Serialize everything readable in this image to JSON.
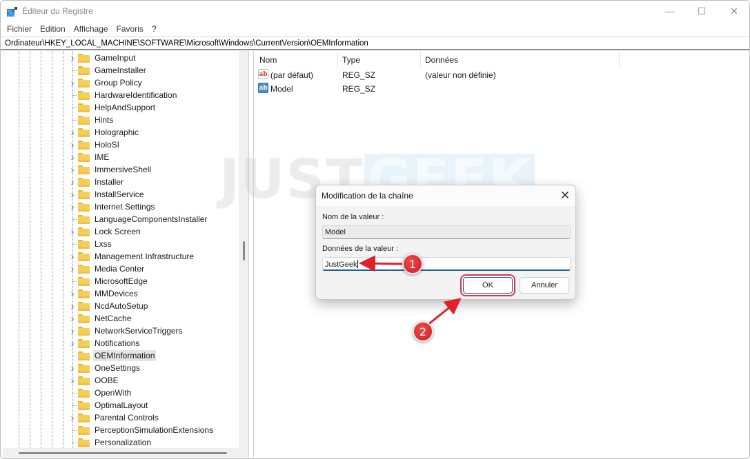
{
  "window": {
    "title": "Éditeur du Registre",
    "controls": {
      "minimize": "—",
      "maximize": "☐",
      "close": "✕"
    }
  },
  "menu": [
    "Fichier",
    "Edition",
    "Affichage",
    "Favoris",
    "?"
  ],
  "address": "Ordinateur\\HKEY_LOCAL_MACHINE\\SOFTWARE\\Microsoft\\Windows\\CurrentVersion\\OEMInformation",
  "tree": {
    "items": [
      {
        "label": "GameInput",
        "expandable": true
      },
      {
        "label": "GameInstaller",
        "expandable": false
      },
      {
        "label": "Group Policy",
        "expandable": true
      },
      {
        "label": "HardwareIdentification",
        "expandable": false
      },
      {
        "label": "HelpAndSupport",
        "expandable": false
      },
      {
        "label": "Hints",
        "expandable": false
      },
      {
        "label": "Holographic",
        "expandable": true
      },
      {
        "label": "HoloSI",
        "expandable": true
      },
      {
        "label": "IME",
        "expandable": true
      },
      {
        "label": "ImmersiveShell",
        "expandable": true
      },
      {
        "label": "Installer",
        "expandable": true
      },
      {
        "label": "InstallService",
        "expandable": true
      },
      {
        "label": "Internet Settings",
        "expandable": true
      },
      {
        "label": "LanguageComponentsInstaller",
        "expandable": false
      },
      {
        "label": "Lock Screen",
        "expandable": true
      },
      {
        "label": "Lxss",
        "expandable": false
      },
      {
        "label": "Management Infrastructure",
        "expandable": true
      },
      {
        "label": "Media Center",
        "expandable": true
      },
      {
        "label": "MicrosoftEdge",
        "expandable": false
      },
      {
        "label": "MMDevices",
        "expandable": true
      },
      {
        "label": "NcdAutoSetup",
        "expandable": true
      },
      {
        "label": "NetCache",
        "expandable": true
      },
      {
        "label": "NetworkServiceTriggers",
        "expandable": true
      },
      {
        "label": "Notifications",
        "expandable": true
      },
      {
        "label": "OEMInformation",
        "expandable": false,
        "selected": true
      },
      {
        "label": "OneSettings",
        "expandable": true
      },
      {
        "label": "OOBE",
        "expandable": true
      },
      {
        "label": "OpenWith",
        "expandable": false
      },
      {
        "label": "OptimalLayout",
        "expandable": false
      },
      {
        "label": "Parental Controls",
        "expandable": true
      },
      {
        "label": "PerceptionSimulationExtensions",
        "expandable": false
      },
      {
        "label": "Personalization",
        "expandable": false
      }
    ]
  },
  "list": {
    "columns": [
      "Nom",
      "Type",
      "Données"
    ],
    "rows": [
      {
        "name": "(par défaut)",
        "type": "REG_SZ",
        "data": "(valeur non définie)",
        "icon": "string-value-icon"
      },
      {
        "name": "Model",
        "type": "REG_SZ",
        "data": "",
        "icon": "string-value-icon"
      }
    ]
  },
  "watermark": {
    "part1": "JUST",
    "part2": "GEEK"
  },
  "dialog": {
    "title": "Modification de la chaîne",
    "name_label": "Nom de la valeur :",
    "name_value": "Model",
    "data_label": "Données de la valeur :",
    "data_value": "JustGeek",
    "ok": "OK",
    "cancel": "Annuler"
  },
  "annotations": [
    {
      "number": "1",
      "color": "#d9272e"
    },
    {
      "number": "2",
      "color": "#d9272e"
    }
  ]
}
